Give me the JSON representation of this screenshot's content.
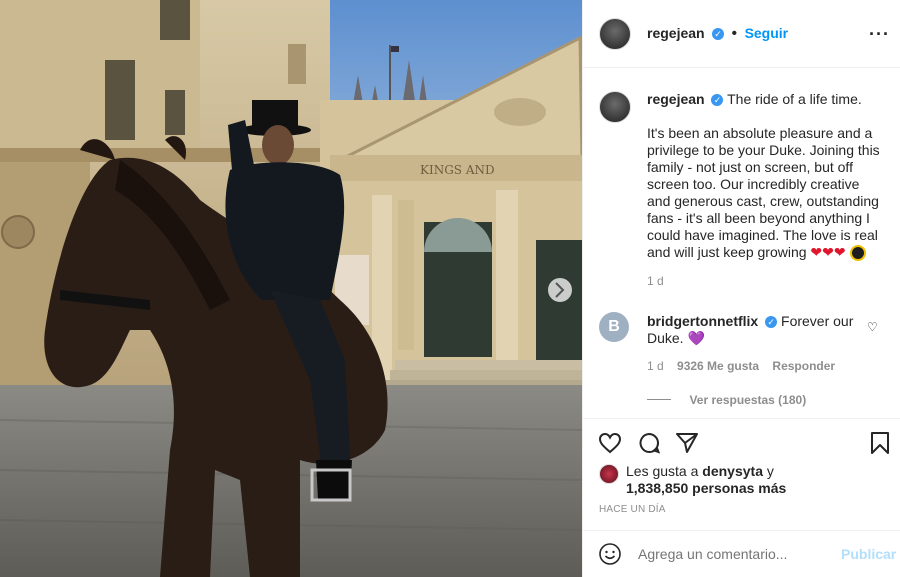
{
  "post": {
    "username": "regejean",
    "follow_label": "Seguir",
    "more_icon": "ellipsis-icon",
    "verified_icon": "verified-badge-icon"
  },
  "caption": {
    "username": "regejean",
    "first_line": "The ride of a life time.",
    "body": "It's been an absolute pleasure and a privilege to be your Duke. Joining this family - not just on screen, but off screen too. Our incredibly creative and generous cast, crew, outstanding fans - it's all been beyond anything I could have imagined. The love is real and will just keep growing",
    "emoji": "❤❤❤",
    "time": "1 d"
  },
  "comment": {
    "avatar_letter": "B",
    "username": "bridgertonnetflix",
    "text": "Forever our Duke.",
    "emoji": "💜",
    "time": "1 d",
    "likes": "9326 Me gusta",
    "reply_label": "Responder",
    "replies_label": "Ver respuestas (180)"
  },
  "actions": {
    "likes_prefix": "Les gusta a",
    "likes_user": "denysyta",
    "likes_suffix": "y",
    "likes_count": "1,838,850 personas más",
    "timestamp": "HACE UN DÍA"
  },
  "add_comment": {
    "placeholder": "Agrega un comentario...",
    "publish_label": "Publicar"
  },
  "scene": {
    "building_sign": "KINGS AND"
  },
  "colors": {
    "accent": "#0095f6",
    "verified": "#3897f0",
    "muted": "#8e8e8e",
    "publish_disabled": "#b2dffc"
  }
}
